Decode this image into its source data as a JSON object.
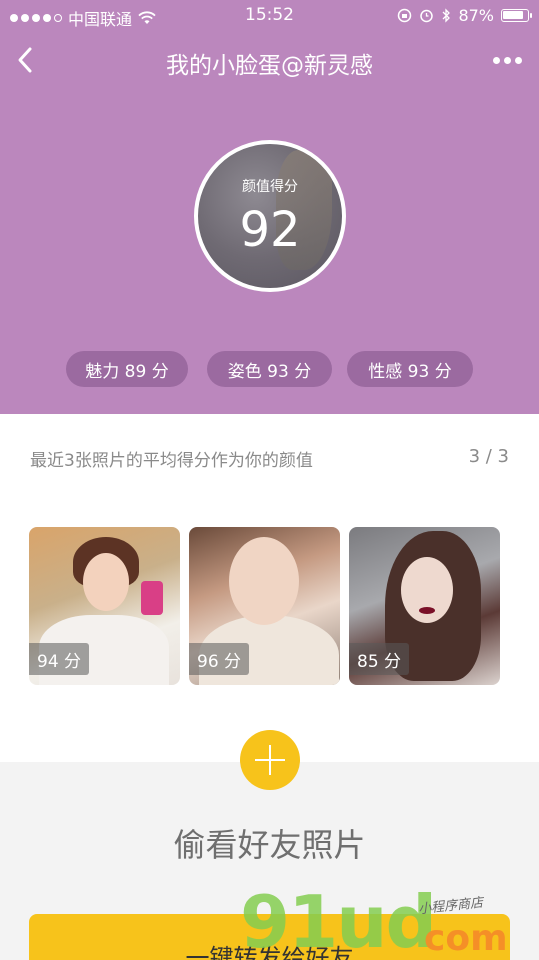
{
  "status_bar": {
    "carrier": "中国联通",
    "time": "15:52",
    "battery": "87%",
    "icons": [
      "signal-dots-icon",
      "wifi-icon",
      "rotation-lock-icon",
      "alarm-icon",
      "bluetooth-icon",
      "battery-icon"
    ]
  },
  "nav": {
    "title": "我的小脸蛋@新灵感",
    "back_icon": "back-chevron-icon",
    "more_icon": "more-dots-icon"
  },
  "score": {
    "label": "颜值得分",
    "value": "92"
  },
  "pills": [
    {
      "label": "魅力 89 分"
    },
    {
      "label": "姿色 93 分"
    },
    {
      "label": "性感 93 分"
    }
  ],
  "photos_header": {
    "text": "最近3张照片的平均得分作为你的颜值",
    "count": "3 / 3"
  },
  "photos": [
    {
      "score": "94 分"
    },
    {
      "score": "96 分"
    },
    {
      "score": "85 分"
    }
  ],
  "add": {
    "icon": "plus-icon"
  },
  "peek": {
    "title": "偷看好友照片"
  },
  "share": {
    "label": "一键转发给好友"
  },
  "watermark": {
    "main": "91ud",
    "suffix": "com",
    "small": "小程序商店"
  },
  "colors": {
    "header_bg": "#bb87bd",
    "pill_bg": "#9b6aa0",
    "accent_yellow": "#f7c31b"
  }
}
